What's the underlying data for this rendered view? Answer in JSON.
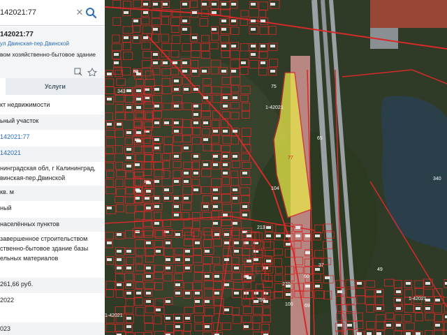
{
  "search": {
    "value": "142021:77"
  },
  "object": {
    "title": "142021:77",
    "address_line": "ул Двинская-пер.Двинской",
    "description": "вом хозяйственно-бытовое здание"
  },
  "tabs": {
    "services": "Услуги"
  },
  "rows": [
    {
      "text": "кт недвижимости",
      "style": "plain"
    },
    {
      "text": "ьный участок",
      "style": "plain"
    },
    {
      "text": "142021:77",
      "style": "link"
    },
    {
      "text": "142021",
      "style": "link"
    },
    {
      "text": "нинградская обл, г Калининград,",
      "style": "plain"
    },
    {
      "text": "винская-пер.Двинской",
      "style": "plain"
    },
    {
      "text": "кв. м",
      "style": "plain"
    },
    {
      "text": "ный",
      "style": "plain"
    },
    {
      "text": "населённых пунктов",
      "style": "plain"
    },
    {
      "text": "завершенное строительством",
      "style": "plain"
    },
    {
      "text": "ственно-бытовое здание базы",
      "style": "plain"
    },
    {
      "text": "ельных материалов",
      "style": "plain"
    },
    {
      "text": "261,66 руб.",
      "style": "plain"
    },
    {
      "text": "2022",
      "style": "plain"
    },
    {
      "text": "023",
      "style": "plain"
    }
  ],
  "map": {
    "highlight_label": "77",
    "labels": [
      "1-42021",
      "75",
      "65",
      "104",
      "343",
      "340",
      "1-42021",
      "270",
      "259",
      "60",
      "37",
      "1-42021",
      "100",
      "213",
      "49",
      "69"
    ],
    "colors": {
      "boundary": "#d42a2a",
      "highlight": "#e8e84a",
      "water": "#2b3f4a",
      "railway": "#f0a0a0"
    }
  }
}
